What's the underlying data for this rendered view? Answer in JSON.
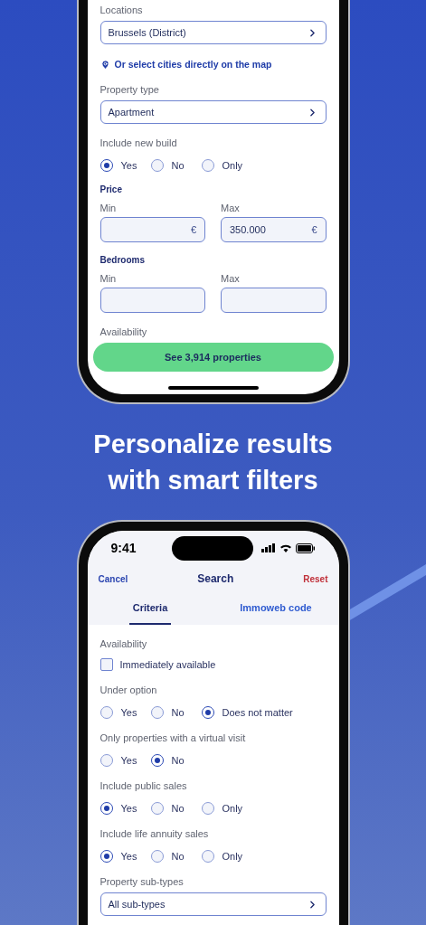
{
  "top_phone": {
    "items": [
      {
        "kind": "select",
        "label": "Locations",
        "value": "Brussels (District)"
      },
      {
        "kind": "link",
        "text": "Or select cities directly on the map"
      },
      {
        "kind": "select",
        "label": "Property type",
        "value": "Apartment"
      },
      {
        "kind": "radio",
        "label": "Include new build",
        "options": [
          {
            "label": "Yes",
            "selected": true
          },
          {
            "label": "No",
            "selected": false
          },
          {
            "label": "Only",
            "selected": false
          }
        ]
      },
      {
        "kind": "range",
        "title": "Price",
        "fields": [
          {
            "label": "Min",
            "suffix": "€"
          },
          {
            "label": "Max",
            "value": "350.000",
            "suffix": "€"
          }
        ]
      },
      {
        "kind": "range",
        "title": "Bedrooms",
        "fields": [
          {
            "label": "Min"
          },
          {
            "label": "Max"
          }
        ]
      },
      {
        "kind": "heading",
        "label": "Availability"
      }
    ],
    "button": "See 3,914 properties"
  },
  "headline": "Personalize results with smart filters",
  "bottom_phone": {
    "status_bar": {
      "time": "9:41"
    },
    "nav": {
      "cancel": "Cancel",
      "title": "Search",
      "reset": "Reset"
    },
    "tabs": [
      {
        "label": "Criteria",
        "selected": true
      },
      {
        "label": "Immoweb code",
        "selected": false
      }
    ],
    "items": [
      {
        "kind": "checkbox",
        "label": "Availability",
        "options": [
          {
            "label": "Immediately available",
            "checked": false
          }
        ]
      },
      {
        "kind": "radio",
        "label": "Under option",
        "options": [
          {
            "label": "Yes",
            "selected": false
          },
          {
            "label": "No",
            "selected": false
          },
          {
            "label": "Does not matter",
            "selected": true
          }
        ]
      },
      {
        "kind": "radio",
        "label": "Only properties with a virtual visit",
        "options": [
          {
            "label": "Yes",
            "selected": false
          },
          {
            "label": "No",
            "selected": true
          }
        ]
      },
      {
        "kind": "radio",
        "label": "Include public sales",
        "options": [
          {
            "label": "Yes",
            "selected": true
          },
          {
            "label": "No",
            "selected": false
          },
          {
            "label": "Only",
            "selected": false
          }
        ]
      },
      {
        "kind": "radio",
        "label": "Include life annuity sales",
        "options": [
          {
            "label": "Yes",
            "selected": true
          },
          {
            "label": "No",
            "selected": false
          },
          {
            "label": "Only",
            "selected": false
          }
        ]
      },
      {
        "kind": "select",
        "label": "Property sub-types",
        "value": "All sub-types"
      }
    ]
  }
}
